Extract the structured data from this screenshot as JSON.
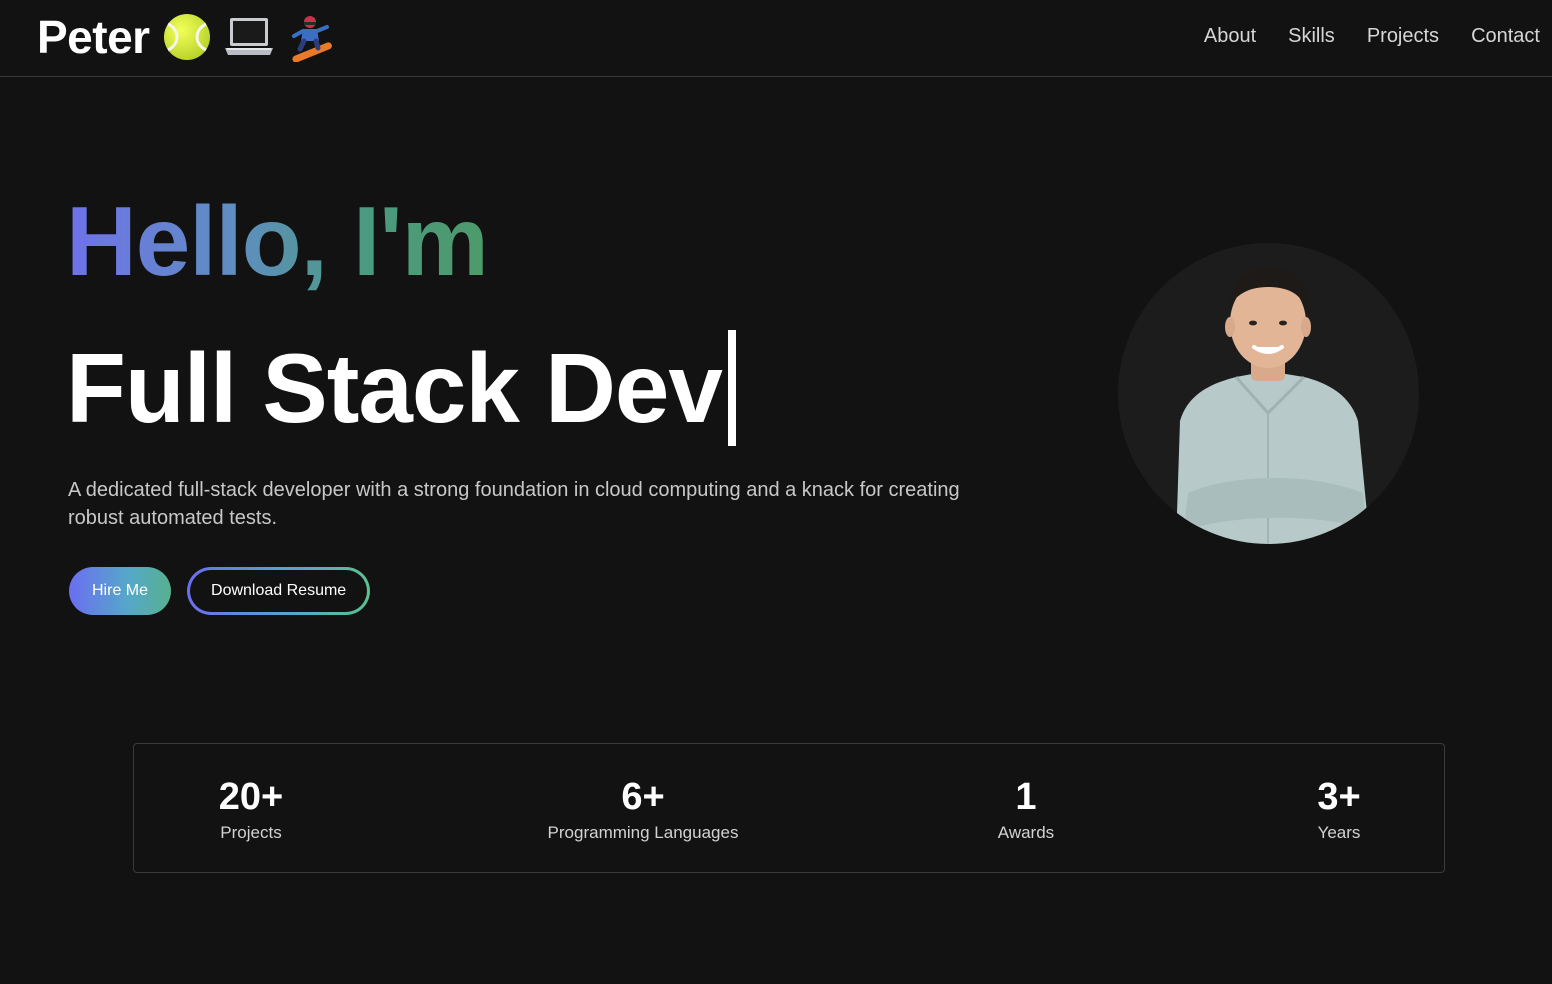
{
  "header": {
    "brand_name": "Peter",
    "brand_icons": [
      "tennis-ball-icon",
      "laptop-icon",
      "snowboarder-icon"
    ],
    "nav": [
      {
        "label": "About"
      },
      {
        "label": "Skills"
      },
      {
        "label": "Projects"
      },
      {
        "label": "Contact"
      }
    ]
  },
  "hero": {
    "greeting": "Hello, I'm",
    "role": "Full Stack Dev",
    "description": "A dedicated full-stack developer with a strong foundation in cloud computing and a knack for creating robust automated tests.",
    "primary_button": "Hire Me",
    "secondary_button": "Download Resume"
  },
  "stats": [
    {
      "value": "20+",
      "label": "Projects"
    },
    {
      "value": "6+",
      "label": "Programming Languages"
    },
    {
      "value": "1",
      "label": "Awards"
    },
    {
      "value": "3+",
      "label": "Years"
    }
  ],
  "colors": {
    "background": "#121212",
    "gradient_start": "#6b6ef0",
    "gradient_end": "#4d9a6a"
  }
}
